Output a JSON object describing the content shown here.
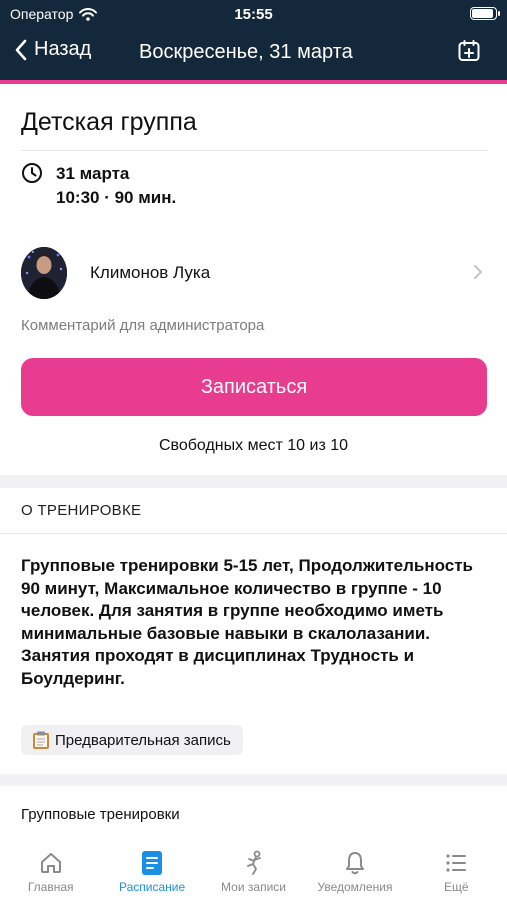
{
  "status_bar": {
    "carrier": "Оператор",
    "time": "15:55",
    "battery_level": 0.95
  },
  "nav": {
    "back_label": "Назад",
    "title": "Воскресенье, 31 марта"
  },
  "event": {
    "title": "Детская группа",
    "date": "31 марта",
    "time_duration": "10:30 · 90 мин.",
    "trainer": "Климонов Лука",
    "comment_placeholder": "Комментарий для администратора",
    "signup_button": "Записаться",
    "seats": "Свободных мест 10 из 10"
  },
  "about": {
    "section_title": "О ТРЕНИРОВКЕ",
    "description": "Групповые тренировки 5-15 лет, Продолжительность 90 минут, Максимальное количество в группе - 10 человек. Для занятия в группе необходимо иметь минимальные базовые навыки в скалолазании. Занятия проходят в дисциплинах Трудность и Боулдеринг.",
    "tag": "Предварительная запись"
  },
  "group_section": {
    "title": "Групповые тренировки"
  },
  "tabbar": {
    "tabs": [
      {
        "label": "Главная",
        "icon": "home-icon"
      },
      {
        "label": "Расписание",
        "icon": "schedule-icon",
        "active": true
      },
      {
        "label": "Мои записи",
        "icon": "climber-icon"
      },
      {
        "label": "Уведомления",
        "icon": "bell-icon"
      },
      {
        "label": "Ещё",
        "icon": "more-icon"
      }
    ]
  },
  "colors": {
    "accent": "#e73c8f",
    "header_bg": "#14283b",
    "tab_active": "#1a8fe3"
  }
}
